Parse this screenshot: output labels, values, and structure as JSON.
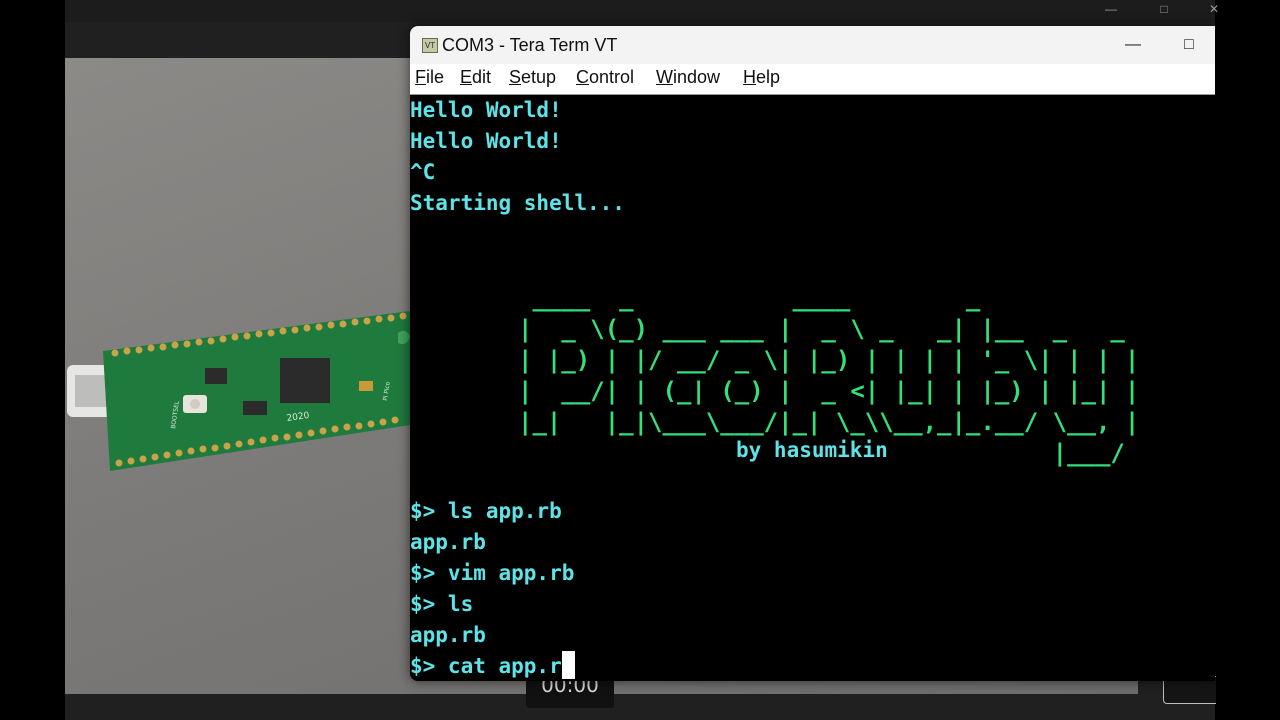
{
  "terminal": {
    "title": "COM3 - Tera Term VT",
    "app_icon_text": "VT",
    "menu": [
      {
        "key": "F",
        "rest": "ile"
      },
      {
        "key": "E",
        "rest": "dit"
      },
      {
        "key": "S",
        "rest": "etup"
      },
      {
        "key": "C",
        "rest": "ontrol"
      },
      {
        "key": "W",
        "rest": "indow"
      },
      {
        "key": "H",
        "rest": "elp"
      }
    ],
    "output_top": [
      "Hello World!",
      "Hello World!",
      "^C",
      "Starting shell..."
    ],
    "banner_ascii": " ____  _           ____        _\n|  _ \\(_) ___ ___ |  _ \\ _   _| |__  _   _\n| |_) | |/ __/ _ \\| |_) | | | | '_ \\| | | |\n|  __/| | (_| (_) |  _ <| |_| | |_) | |_| |\n|_|   |_|\\___\\___/|_| \\_\\\\__,_|_.__/ \\__, |\n                                     |___/",
    "byline": "by hasumikin",
    "session": [
      "$> ls app.rb",
      "app.rb",
      "$> vim app.rb",
      "$> ls",
      "app.rb"
    ],
    "current_input": "$> cat app.r"
  },
  "viewer": {
    "timer": "00:00"
  },
  "board": {
    "silkscreen_year": "2020",
    "silkscreen_button": "BOOTSEL",
    "silkscreen_model": "Pi Pico"
  },
  "colors": {
    "terminal_text": "#5ee4e8",
    "banner_text": "#33e07a",
    "terminal_bg": "#000000"
  }
}
